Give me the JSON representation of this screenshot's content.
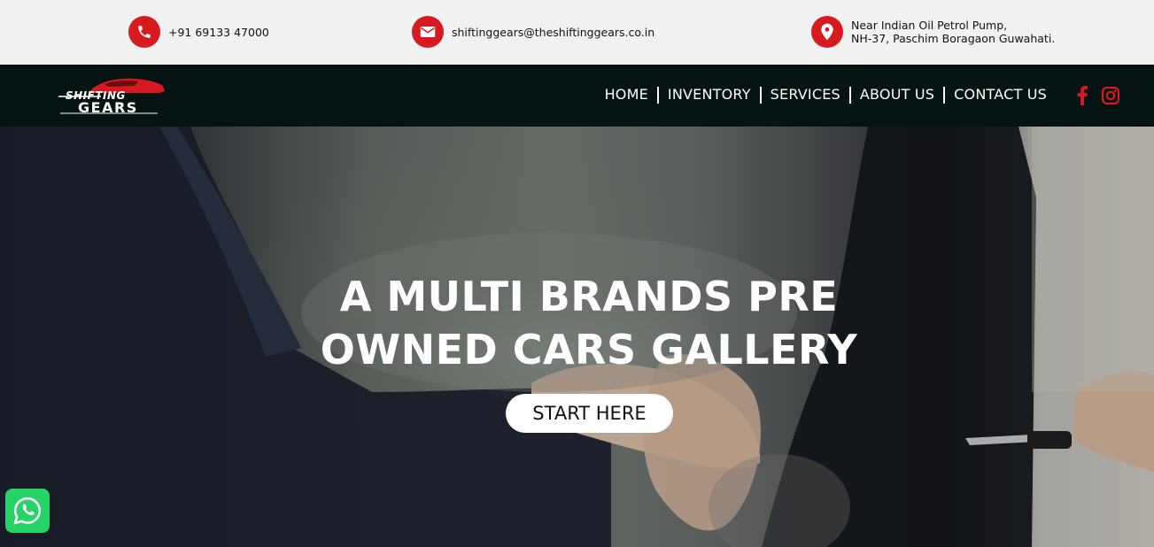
{
  "topbar": {
    "phone": {
      "icon": "phone-icon",
      "text": "+91 69133 47000"
    },
    "email": {
      "icon": "envelope-icon",
      "text": "shiftinggears@theshiftinggears.co.in"
    },
    "address": {
      "icon": "location-pin-icon",
      "line1": "Near Indian Oil Petrol Pump,",
      "line2": "NH-37, Paschim Boragaon Guwahati."
    }
  },
  "logo": {
    "line1": "SHIFTING",
    "line2": "GEARS"
  },
  "nav": {
    "items": [
      {
        "label": "HOME"
      },
      {
        "label": "INVENTORY"
      },
      {
        "label": "SERVICES"
      },
      {
        "label": "ABOUT US"
      },
      {
        "label": "CONTACT US"
      }
    ],
    "social": [
      "facebook-icon",
      "instagram-icon"
    ]
  },
  "hero": {
    "title_line1": "A MULTI BRANDS PRE",
    "title_line2": "OWNED CARS GALLERY",
    "button_label": "START HERE"
  },
  "widgets": {
    "whatsapp_icon": "whatsapp-icon"
  },
  "colors": {
    "accent": "#d71920",
    "nav_bg": "#051313",
    "topbar_bg": "#f2f1f1",
    "whatsapp": "#25d366"
  }
}
